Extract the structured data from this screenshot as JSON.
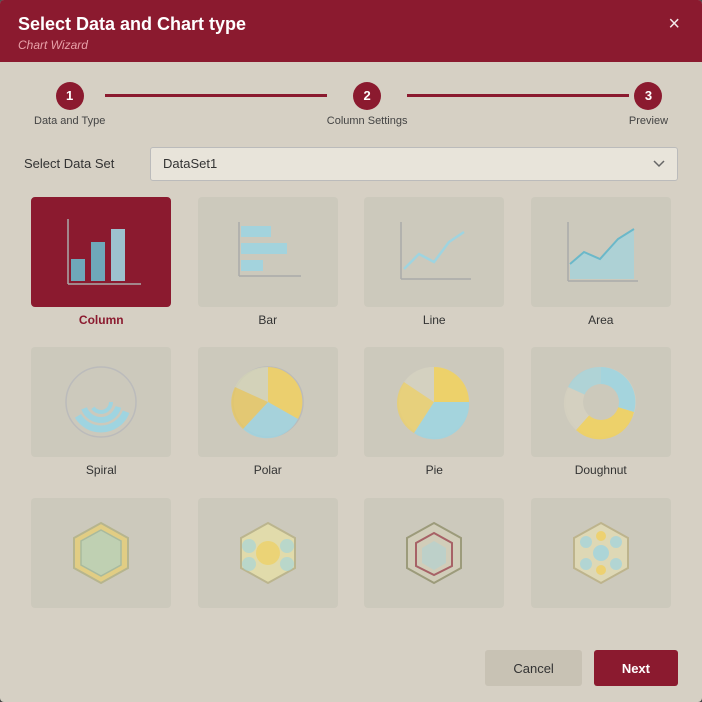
{
  "dialog": {
    "title": "Select Data and Chart type",
    "subtitle": "Chart Wizard",
    "close_label": "×"
  },
  "stepper": {
    "steps": [
      {
        "number": "1",
        "label": "Data and Type"
      },
      {
        "number": "2",
        "label": "Column Settings"
      },
      {
        "number": "3",
        "label": "Preview"
      }
    ]
  },
  "dataset": {
    "label": "Select Data Set",
    "value": "DataSet1",
    "placeholder": "DataSet1"
  },
  "charts": [
    {
      "id": "column",
      "label": "Column",
      "selected": true
    },
    {
      "id": "bar",
      "label": "Bar",
      "selected": false
    },
    {
      "id": "line",
      "label": "Line",
      "selected": false
    },
    {
      "id": "area",
      "label": "Area",
      "selected": false
    },
    {
      "id": "spiral",
      "label": "Spiral",
      "selected": false
    },
    {
      "id": "polar",
      "label": "Polar",
      "selected": false
    },
    {
      "id": "pie",
      "label": "Pie",
      "selected": false
    },
    {
      "id": "doughnut",
      "label": "Doughnut",
      "selected": false
    },
    {
      "id": "hexbin1",
      "label": "",
      "selected": false
    },
    {
      "id": "hexbin2",
      "label": "",
      "selected": false
    },
    {
      "id": "hexbin3",
      "label": "",
      "selected": false
    },
    {
      "id": "hexbin4",
      "label": "",
      "selected": false
    }
  ],
  "footer": {
    "cancel_label": "Cancel",
    "next_label": "Next"
  }
}
